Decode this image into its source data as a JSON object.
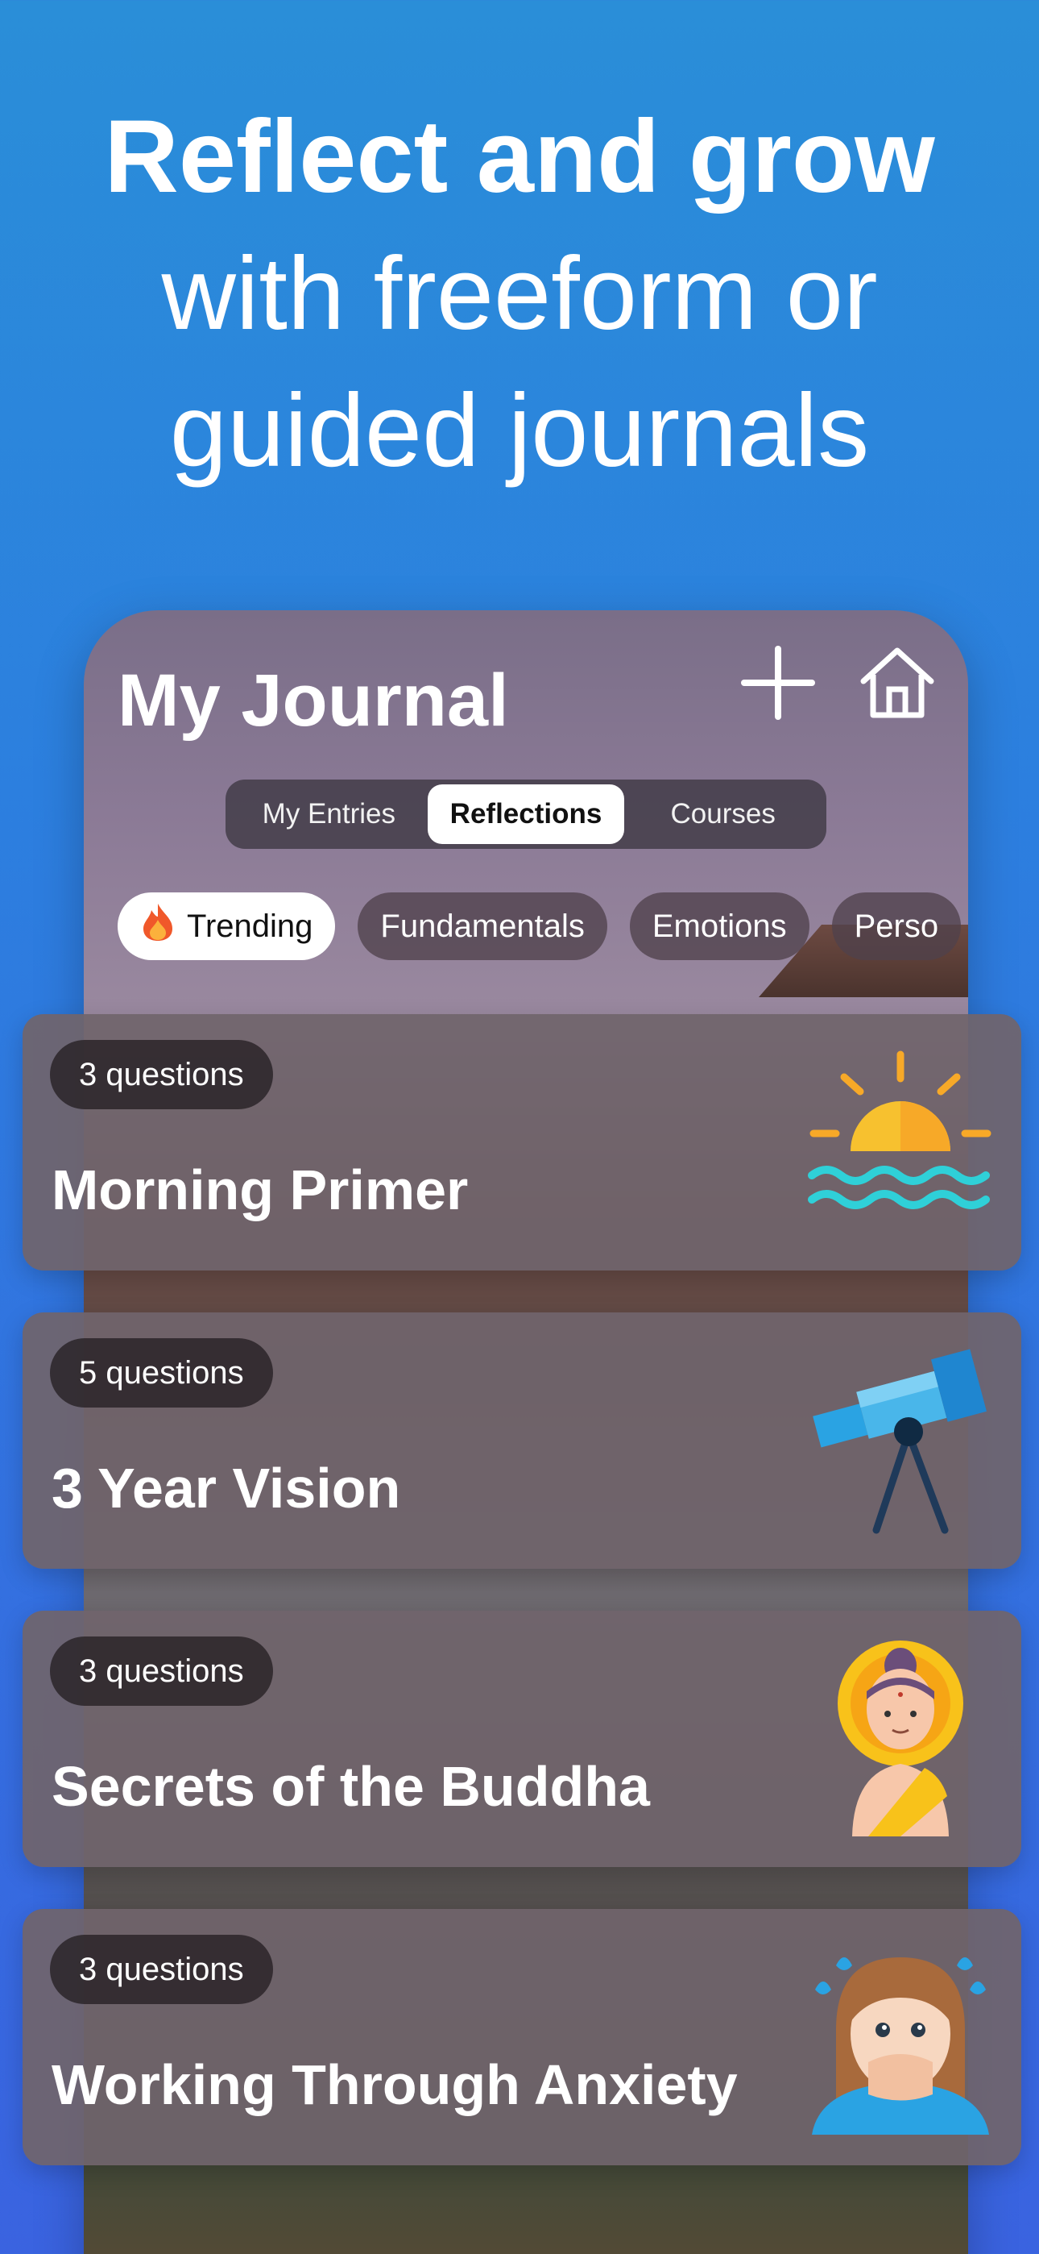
{
  "headline": {
    "line1": "Reflect and grow",
    "line2": "with freeform or",
    "line3": "guided journals"
  },
  "app": {
    "title": "My Journal",
    "segments": [
      "My Entries",
      "Reflections",
      "Courses"
    ],
    "active_segment": "Reflections",
    "chips": [
      "Trending",
      "Fundamentals",
      "Emotions",
      "Perso"
    ],
    "active_chip": "Trending",
    "icons": [
      "plus-icon",
      "home-icon",
      "flame-icon"
    ]
  },
  "cards": [
    {
      "badge": "3 questions",
      "title": "Morning Primer",
      "art": "sunrise-icon"
    },
    {
      "badge": "5 questions",
      "title": "3 Year Vision",
      "art": "telescope-icon"
    },
    {
      "badge": "3 questions",
      "title": "Secrets of the Buddha",
      "art": "buddha-icon"
    },
    {
      "badge": "3 questions",
      "title": "Working Through Anxiety",
      "art": "anxious-face-icon"
    }
  ],
  "colors": {
    "background_top": "#2a8ed8",
    "background_bottom": "#3a63e0",
    "card": "#70646c"
  }
}
